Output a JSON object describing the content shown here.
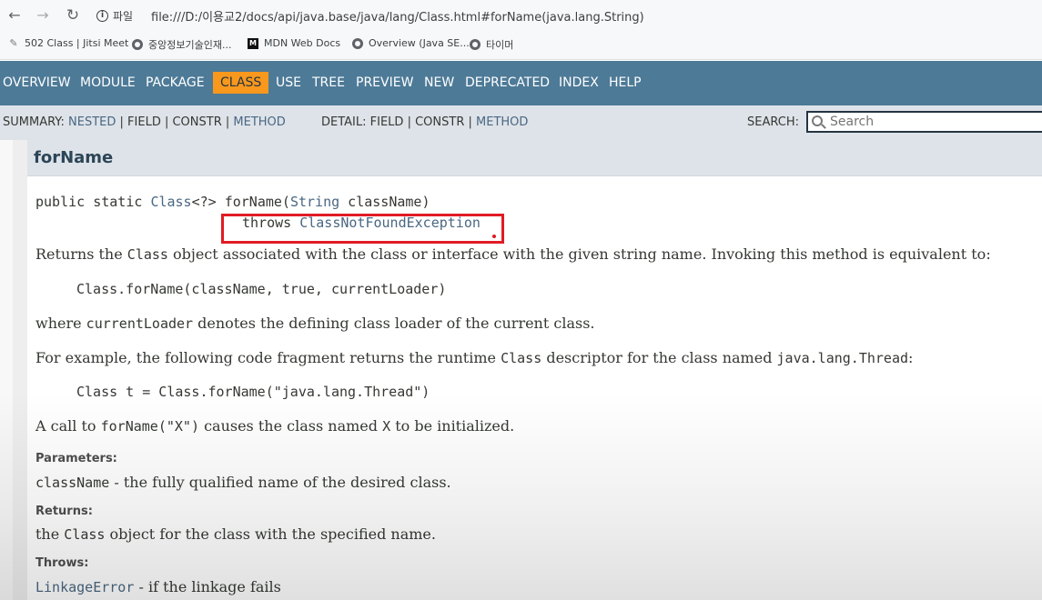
{
  "browser": {
    "url_chip_label": "파일",
    "url": "file:///D:/이용교2/docs/api/java.base/java/lang/Class.html#forName(java.lang.String)",
    "back_glyph": "←",
    "forward_glyph": "→",
    "reload_glyph": "↻",
    "bookmarks": [
      {
        "label": "502 Class | Jitsi Meet",
        "icon": "jitsi-icon"
      },
      {
        "label": "중앙정보기술인재...",
        "icon": "globe-icon"
      },
      {
        "label": "MDN Web Docs",
        "icon": "mdn-icon"
      },
      {
        "label": "Overview (Java SE...",
        "icon": "globe-icon"
      },
      {
        "label": "타이머",
        "icon": "globe-icon"
      }
    ]
  },
  "topnav": {
    "items": [
      "OVERVIEW",
      "MODULE",
      "PACKAGE",
      "CLASS",
      "USE",
      "TREE",
      "PREVIEW",
      "NEW",
      "DEPRECATED",
      "INDEX",
      "HELP"
    ],
    "active": "CLASS",
    "active_color": "#f8981d",
    "bar_color": "#4d7a97"
  },
  "subnav": {
    "summary_label": "SUMMARY:",
    "summary_nested": "NESTED",
    "summary_field": "FIELD",
    "summary_constr": "CONSTR",
    "summary_method": "METHOD",
    "detail_label": "DETAIL:",
    "detail_field": "FIELD",
    "detail_constr": "CONSTR",
    "detail_method": "METHOD",
    "sep": " | ",
    "search_label": "SEARCH:",
    "search_placeholder": "Search"
  },
  "member": {
    "title": "forName",
    "sig_prefix": "public static ",
    "sig_class": "Class",
    "sig_generic": "<?> forName(",
    "sig_param_type": "String",
    "sig_param_name": " className)",
    "sig_throws": "throws ",
    "sig_exception": "ClassNotFoundException",
    "highlight_color": "#e01b24",
    "desc1_a": "Returns the ",
    "desc1_code": "Class",
    "desc1_b": " object associated with the class or interface with the given string name. Invoking this method is equivalent to:",
    "code1": "Class.forName(className, true, currentLoader)",
    "desc2_a": "where ",
    "desc2_code": "currentLoader",
    "desc2_b": " denotes the defining class loader of the current class.",
    "desc3_a": "For example, the following code fragment returns the runtime ",
    "desc3_code1": "Class",
    "desc3_b": " descriptor for the class named ",
    "desc3_code2": "java.lang.Thread",
    "desc3_c": ":",
    "code2": "Class t = Class.forName(\"java.lang.Thread\")",
    "desc4_a": "A call to ",
    "desc4_code1": "forName(\"X\")",
    "desc4_b": " causes the class named ",
    "desc4_code2": "X",
    "desc4_c": " to be initialized.",
    "params_label": "Parameters:",
    "param_name": "className",
    "param_desc": " - the fully qualified name of the desired class.",
    "returns_label": "Returns:",
    "returns_a": "the ",
    "returns_code": "Class",
    "returns_b": " object for the class with the specified name.",
    "throws_label": "Throws:",
    "throws_name": "LinkageError",
    "throws_desc": " - if the linkage fails"
  }
}
